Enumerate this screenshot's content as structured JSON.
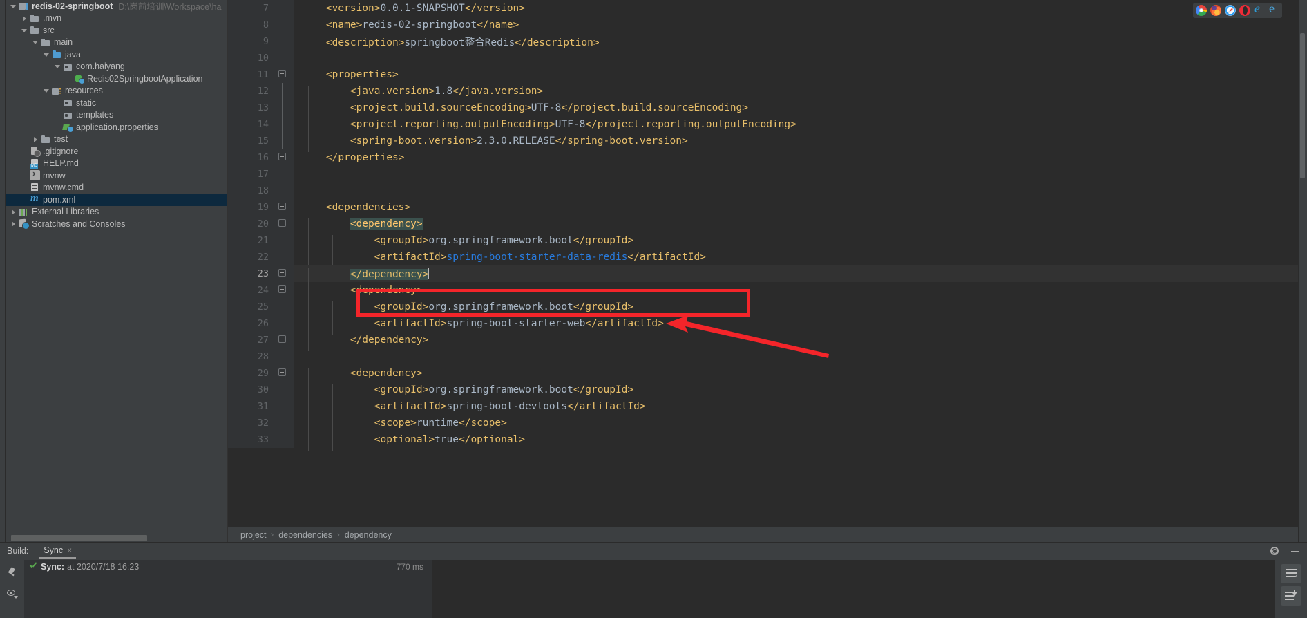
{
  "sidebar": {
    "tree": [
      {
        "indent": 0,
        "arrow": "open",
        "icon": "module-icon",
        "label": "redis-02-springboot",
        "bold": true,
        "path": "D:\\岗前培训\\Workspace\\ha",
        "partial": true
      },
      {
        "indent": 1,
        "arrow": "closed",
        "icon": "folder-icon",
        "label": ".mvn"
      },
      {
        "indent": 1,
        "arrow": "open",
        "icon": "folder-icon",
        "label": "src"
      },
      {
        "indent": 2,
        "arrow": "open",
        "icon": "folder-icon",
        "label": "main"
      },
      {
        "indent": 3,
        "arrow": "open",
        "icon": "source-folder-icon",
        "label": "java"
      },
      {
        "indent": 4,
        "arrow": "open",
        "icon": "package-icon",
        "label": "com.haiyang"
      },
      {
        "indent": 5,
        "arrow": "none",
        "icon": "spring-class-icon",
        "label": "Redis02SpringbootApplication"
      },
      {
        "indent": 3,
        "arrow": "open",
        "icon": "resources-folder-icon",
        "label": "resources"
      },
      {
        "indent": 4,
        "arrow": "none",
        "icon": "package-icon",
        "label": "static"
      },
      {
        "indent": 4,
        "arrow": "none",
        "icon": "package-icon",
        "label": "templates"
      },
      {
        "indent": 4,
        "arrow": "none",
        "icon": "properties-icon",
        "label": "application.properties"
      },
      {
        "indent": 2,
        "arrow": "closed",
        "icon": "folder-icon",
        "label": "test"
      },
      {
        "indent": 1,
        "arrow": "none",
        "icon": "gitignore-icon",
        "label": ".gitignore"
      },
      {
        "indent": 1,
        "arrow": "none",
        "icon": "markdown-icon",
        "label": "HELP.md"
      },
      {
        "indent": 1,
        "arrow": "none",
        "icon": "shell-icon",
        "label": "mvnw"
      },
      {
        "indent": 1,
        "arrow": "none",
        "icon": "cmd-icon",
        "label": "mvnw.cmd"
      },
      {
        "indent": 1,
        "arrow": "none",
        "icon": "maven-pom-icon",
        "label": "pom.xml",
        "selected": true
      },
      {
        "indent": 0,
        "arrow": "closed",
        "icon": "libraries-icon",
        "label": "External Libraries"
      },
      {
        "indent": 0,
        "arrow": "closed",
        "icon": "scratches-icon",
        "label": "Scratches and Consoles"
      }
    ]
  },
  "editor": {
    "lines": [
      {
        "num": 7,
        "current": false,
        "fold": "none",
        "maven": false,
        "indent": 0,
        "spans": [
          {
            "c": "tag",
            "t": "    <version>"
          },
          {
            "c": "txt",
            "t": "0.0.1-SNAPSHOT"
          },
          {
            "c": "tag",
            "t": "</version>"
          }
        ]
      },
      {
        "num": 8,
        "current": false,
        "fold": "none",
        "maven": false,
        "indent": 0,
        "spans": [
          {
            "c": "tag",
            "t": "    <name>"
          },
          {
            "c": "txt",
            "t": "redis-02-springboot"
          },
          {
            "c": "tag",
            "t": "</name>"
          }
        ]
      },
      {
        "num": 9,
        "current": false,
        "fold": "none",
        "maven": false,
        "indent": 0,
        "spans": [
          {
            "c": "tag",
            "t": "    <description>"
          },
          {
            "c": "txt",
            "t": "springboot整合Redis"
          },
          {
            "c": "tag",
            "t": "</description>"
          }
        ]
      },
      {
        "num": 10,
        "current": false,
        "fold": "none",
        "maven": false,
        "indent": 0,
        "spans": []
      },
      {
        "num": 11,
        "current": false,
        "fold": "minus",
        "maven": false,
        "indent": 0,
        "spans": [
          {
            "c": "tag",
            "t": "    <properties>"
          }
        ]
      },
      {
        "num": 12,
        "current": false,
        "fold": "none",
        "maven": false,
        "indent": 1,
        "spans": [
          {
            "c": "tag",
            "t": "        <java.version>"
          },
          {
            "c": "txt",
            "t": "1.8"
          },
          {
            "c": "tag",
            "t": "</java.version>"
          }
        ]
      },
      {
        "num": 13,
        "current": false,
        "fold": "none",
        "maven": false,
        "indent": 1,
        "spans": [
          {
            "c": "tag",
            "t": "        <project.build.sourceEncoding>"
          },
          {
            "c": "txt",
            "t": "UTF-8"
          },
          {
            "c": "tag",
            "t": "</project.build.sourceEncoding>"
          }
        ]
      },
      {
        "num": 14,
        "current": false,
        "fold": "none",
        "maven": false,
        "indent": 1,
        "spans": [
          {
            "c": "tag",
            "t": "        <project.reporting.outputEncoding>"
          },
          {
            "c": "txt",
            "t": "UTF-8"
          },
          {
            "c": "tag",
            "t": "</project.reporting.outputEncoding>"
          }
        ]
      },
      {
        "num": 15,
        "current": false,
        "fold": "none",
        "maven": false,
        "indent": 1,
        "spans": [
          {
            "c": "tag",
            "t": "        <spring-boot.version>"
          },
          {
            "c": "txt",
            "t": "2.3.0.RELEASE"
          },
          {
            "c": "tag",
            "t": "</spring-boot.version>"
          }
        ]
      },
      {
        "num": 16,
        "current": false,
        "fold": "minus",
        "maven": false,
        "indent": 0,
        "spans": [
          {
            "c": "tag",
            "t": "    </properties>"
          }
        ]
      },
      {
        "num": 17,
        "current": false,
        "fold": "none",
        "maven": false,
        "indent": 0,
        "spans": []
      },
      {
        "num": 18,
        "current": false,
        "fold": "none",
        "maven": false,
        "indent": 0,
        "spans": []
      },
      {
        "num": 19,
        "current": false,
        "fold": "minus",
        "maven": false,
        "indent": 0,
        "spans": [
          {
            "c": "tag",
            "t": "    <dependencies>"
          }
        ]
      },
      {
        "num": 20,
        "current": false,
        "fold": "minus",
        "maven": true,
        "indent": 1,
        "spans": [
          {
            "c": "tag",
            "t": "        "
          },
          {
            "c": "brace-match",
            "t": "<dependency>"
          }
        ]
      },
      {
        "num": 21,
        "current": false,
        "fold": "none",
        "maven": false,
        "indent": 2,
        "spans": [
          {
            "c": "tag",
            "t": "            <groupId>"
          },
          {
            "c": "txt",
            "t": "org.springframework.boot"
          },
          {
            "c": "tag",
            "t": "</groupId>"
          }
        ]
      },
      {
        "num": 22,
        "current": false,
        "fold": "none",
        "maven": false,
        "indent": 2,
        "spans": [
          {
            "c": "tag",
            "t": "            <artifactId>"
          },
          {
            "c": "link",
            "t": "spring-boot-starter-data-redis"
          },
          {
            "c": "tag",
            "t": "</artifactId>"
          }
        ]
      },
      {
        "num": 23,
        "current": true,
        "fold": "minus",
        "maven": false,
        "indent": 1,
        "spans": [
          {
            "c": "tag",
            "t": "        "
          },
          {
            "c": "hl-close",
            "t": "</dependency>"
          },
          {
            "c": "caret",
            "t": ""
          }
        ]
      },
      {
        "num": 24,
        "current": false,
        "fold": "minus",
        "maven": true,
        "indent": 1,
        "spans": [
          {
            "c": "tag",
            "t": "        <dependency>"
          }
        ]
      },
      {
        "num": 25,
        "current": false,
        "fold": "none",
        "maven": false,
        "indent": 2,
        "spans": [
          {
            "c": "tag",
            "t": "            <groupId>"
          },
          {
            "c": "txt",
            "t": "org.springframework.boot"
          },
          {
            "c": "tag",
            "t": "</groupId>"
          }
        ]
      },
      {
        "num": 26,
        "current": false,
        "fold": "none",
        "maven": false,
        "indent": 2,
        "spans": [
          {
            "c": "tag",
            "t": "            <artifactId>"
          },
          {
            "c": "txt",
            "t": "spring-boot-starter-web"
          },
          {
            "c": "tag",
            "t": "</artifactId>"
          }
        ]
      },
      {
        "num": 27,
        "current": false,
        "fold": "minus",
        "maven": false,
        "indent": 1,
        "spans": [
          {
            "c": "tag",
            "t": "        </dependency>"
          }
        ]
      },
      {
        "num": 28,
        "current": false,
        "fold": "none",
        "maven": false,
        "indent": 0,
        "spans": []
      },
      {
        "num": 29,
        "current": false,
        "fold": "minus",
        "maven": true,
        "indent": 1,
        "spans": [
          {
            "c": "tag",
            "t": "        <dependency>"
          }
        ]
      },
      {
        "num": 30,
        "current": false,
        "fold": "none",
        "maven": false,
        "indent": 2,
        "spans": [
          {
            "c": "tag",
            "t": "            <groupId>"
          },
          {
            "c": "txt",
            "t": "org.springframework.boot"
          },
          {
            "c": "tag",
            "t": "</groupId>"
          }
        ]
      },
      {
        "num": 31,
        "current": false,
        "fold": "none",
        "maven": false,
        "indent": 2,
        "spans": [
          {
            "c": "tag",
            "t": "            <artifactId>"
          },
          {
            "c": "txt",
            "t": "spring-boot-devtools"
          },
          {
            "c": "tag",
            "t": "</artifactId>"
          }
        ]
      },
      {
        "num": 32,
        "current": false,
        "fold": "none",
        "maven": false,
        "indent": 2,
        "spans": [
          {
            "c": "tag",
            "t": "            <scope>"
          },
          {
            "c": "txt",
            "t": "runtime"
          },
          {
            "c": "tag",
            "t": "</scope>"
          }
        ]
      },
      {
        "num": 33,
        "current": false,
        "fold": "none",
        "maven": false,
        "indent": 2,
        "spans": [
          {
            "c": "tag",
            "t": "            <optional>"
          },
          {
            "c": "txt",
            "t": "true"
          },
          {
            "c": "tag",
            "t": "</optional>"
          }
        ]
      }
    ],
    "breadcrumb": [
      "project",
      "dependencies",
      "dependency"
    ],
    "breadcrumb_separator": "›"
  },
  "browsers": [
    {
      "name": "chrome-icon",
      "cls": "bi-chrome"
    },
    {
      "name": "firefox-icon",
      "cls": "bi-firefox"
    },
    {
      "name": "safari-icon",
      "cls": "bi-safari"
    },
    {
      "name": "opera-icon",
      "cls": "bi-opera"
    },
    {
      "name": "edge-icon",
      "cls": "bi-edge"
    },
    {
      "name": "internet-explorer-icon",
      "cls": "bi-ie"
    }
  ],
  "build": {
    "label": "Build:",
    "tab": "Sync",
    "tab_close": "×",
    "item": {
      "name": "Sync:",
      "time": "at 2020/7/18 16:23",
      "duration": "770 ms"
    }
  },
  "colors": {
    "annotation_red": "#f4252a",
    "tag": "#e8bf6a",
    "text": "#a9b7c6",
    "link": "#287bde",
    "highlight": "#3b514d",
    "selection": "#0d293e",
    "editor_bg": "#2b2b2b",
    "panel_bg": "#3c3f41"
  }
}
